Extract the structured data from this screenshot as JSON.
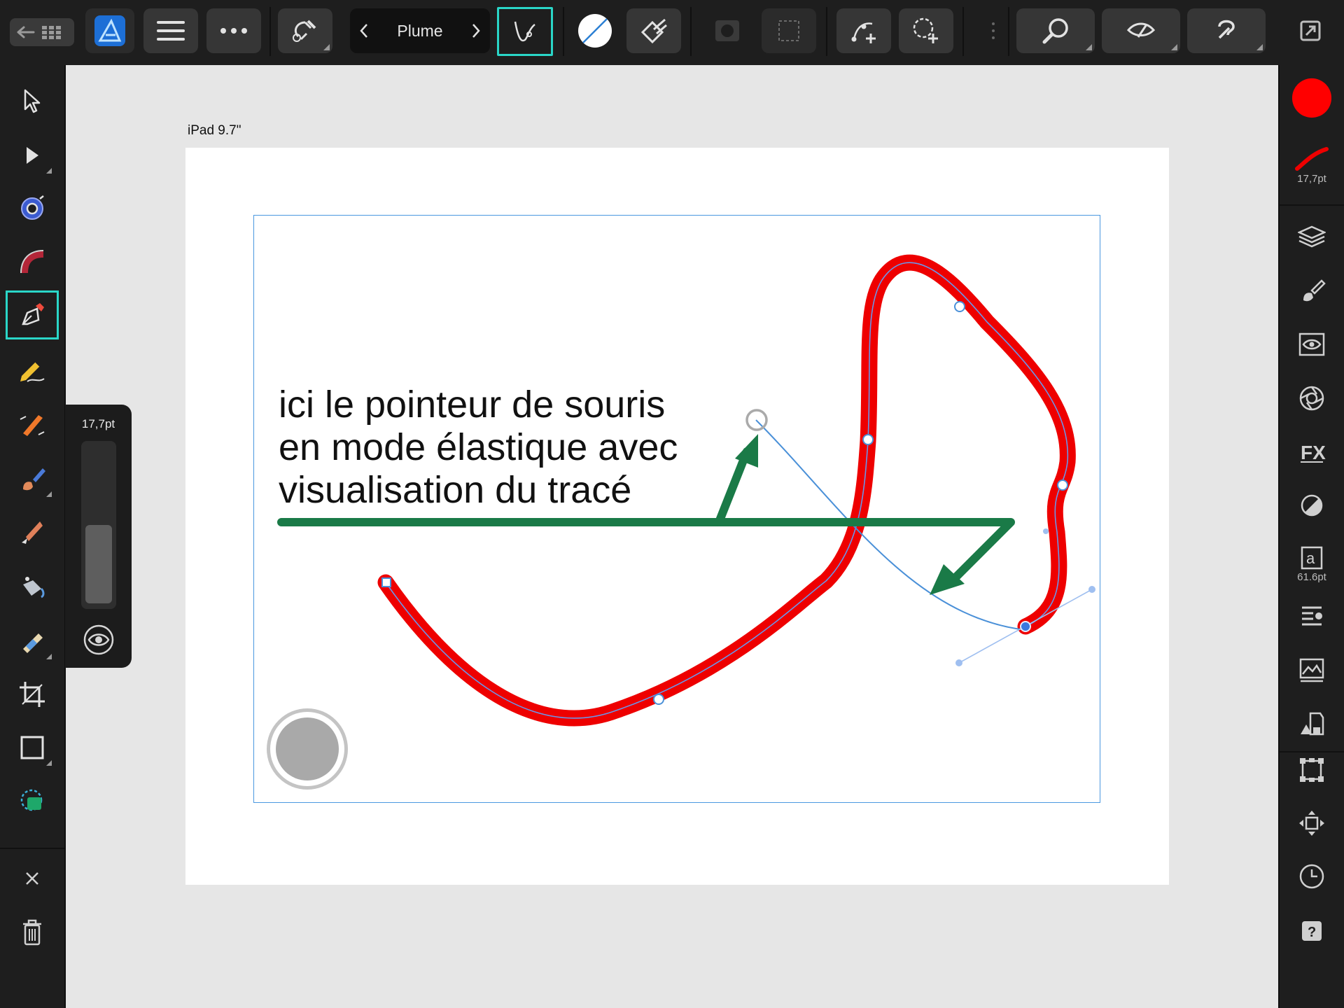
{
  "toolbar": {
    "tool_name": "Plume",
    "buttons": [
      {
        "name": "back-grid-icon"
      },
      {
        "name": "designer-persona-icon"
      },
      {
        "name": "menu-icon"
      },
      {
        "name": "more-icon"
      },
      {
        "name": "snapping-magnet-icon"
      },
      {
        "name": "rubber-band-mode-icon"
      },
      {
        "name": "fill-none-icon"
      },
      {
        "name": "stroke-brush-icon"
      },
      {
        "name": "quick-mask-icon"
      },
      {
        "name": "selection-marquee-icon"
      },
      {
        "name": "add-node-icon"
      },
      {
        "name": "boolean-add-icon"
      },
      {
        "name": "zoom-icon"
      },
      {
        "name": "view-mode-icon"
      },
      {
        "name": "assistant-icon"
      },
      {
        "name": "document-export-icon"
      }
    ]
  },
  "left_tools": [
    "move-tool-icon",
    "node-tool-icon",
    "point-transform-icon",
    "corner-tool-icon",
    "pen-tool-icon",
    "pencil-tool-icon",
    "vector-brush-icon",
    "paint-brush-icon",
    "fill-tool-icon",
    "paint-bucket-icon",
    "transparency-tool-icon",
    "crop-tool-icon",
    "rectangle-tool-icon",
    "place-image-icon",
    "close-icon",
    "trash-icon"
  ],
  "size_popover": {
    "value": "17,7pt",
    "level": 0.5
  },
  "right_panel": {
    "fill_color": "#ff0000",
    "stroke_size": "17,7pt",
    "text_size": "61.6pt",
    "studios": [
      "layers-icon",
      "brushes-icon",
      "visibility-icon",
      "appearance-icon",
      "fx-icon",
      "color-icon",
      "text-styles-icon",
      "paragraph-icon",
      "image-stock-icon",
      "assets-icon",
      "transform-icon",
      "navigator-icon",
      "history-icon",
      "help-icon"
    ]
  },
  "canvas": {
    "artboard_label": "iPad 9.7\"",
    "annotation_lines": [
      "ici le pointeur de souris",
      "en mode élastique avec",
      "visualisation du tracé"
    ],
    "curve_color": "#ee0000",
    "arrow_color": "#1a7a47",
    "selection_color": "#4a98e0"
  }
}
